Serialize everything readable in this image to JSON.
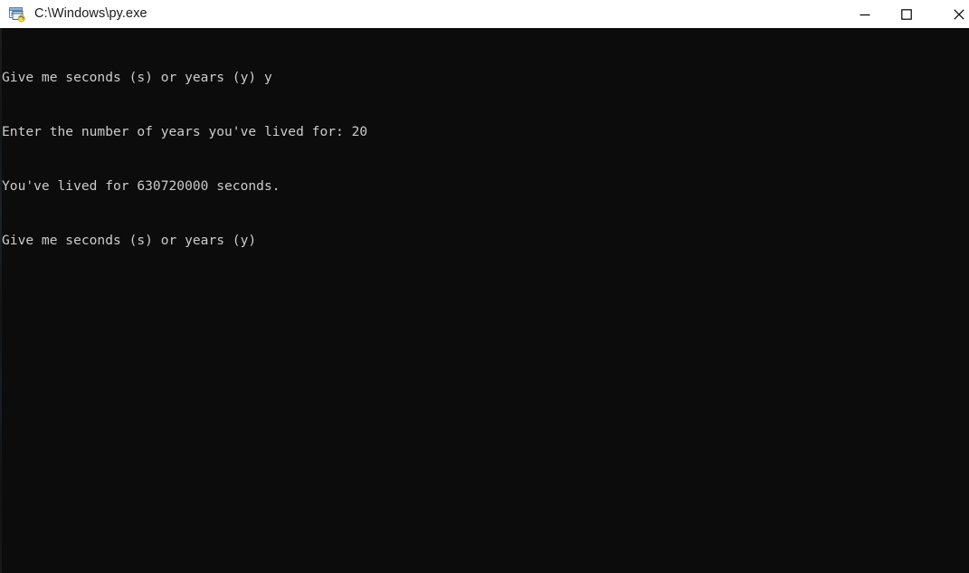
{
  "window": {
    "title": "C:\\Windows\\py.exe",
    "icon": "python-console-icon",
    "background_color": "#0c0c0c",
    "titlebar_color": "#ffffff",
    "titlebar_text_color": "#1a1a1a"
  },
  "controls": {
    "minimize": {
      "label": "Minimize",
      "icon": "minimize-icon"
    },
    "maximize": {
      "label": "Maximize",
      "icon": "maximize-icon"
    },
    "close": {
      "label": "Close",
      "icon": "close-icon"
    }
  },
  "console": {
    "foreground_color": "#cccccc",
    "background_color": "#0c0c0c",
    "lines": [
      "Give me seconds (s) or years (y) y",
      "Enter the number of years you've lived for: 20",
      "You've lived for 630720000 seconds.",
      "Give me seconds (s) or years (y)"
    ]
  }
}
